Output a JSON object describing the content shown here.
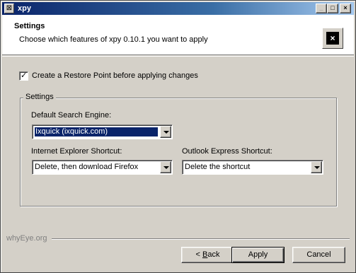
{
  "window": {
    "title": "xpy",
    "icon": "app-icon",
    "controls": {
      "minimize": "_",
      "maximize": "□",
      "close": "×"
    }
  },
  "header": {
    "title": "Settings",
    "subtitle": "Choose which features of xpy 0.10.1 you want to apply",
    "logo": "xpy-logo-icon",
    "logo_glyph": "×"
  },
  "restore_point": {
    "label": "Create a Restore Point before applying changes",
    "checked": true,
    "check_glyph": "✓"
  },
  "settings_group": {
    "legend": "Settings",
    "search_engine": {
      "label": "Default Search Engine:",
      "value": "Ixquick (ixquick.com)"
    },
    "ie_shortcut": {
      "label": "Internet Explorer Shortcut:",
      "value": "Delete, then download Firefox"
    },
    "oe_shortcut": {
      "label": "Outlook Express Shortcut:",
      "value": "Delete the shortcut"
    }
  },
  "footer": {
    "brand": "whyEye.org",
    "back_prefix": "< ",
    "back_mnemonic": "B",
    "back_rest": "ack",
    "apply": "Apply",
    "cancel": "Cancel"
  }
}
